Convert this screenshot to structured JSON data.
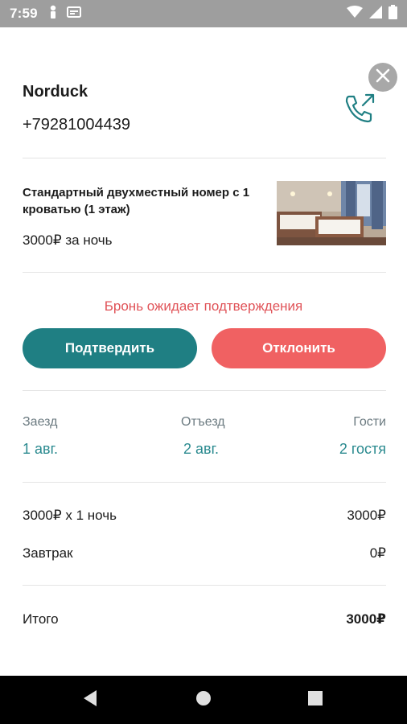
{
  "status_bar": {
    "time": "7:59",
    "icons": [
      "person-notification-icon",
      "sim-card-icon",
      "wifi-icon",
      "cellular-signal-icon",
      "battery-icon"
    ],
    "background": "#9e9e9e"
  },
  "header": {
    "close_icon": "close-icon",
    "host_name": "Norduck",
    "phone": "+79281004439",
    "call_icon": "phone-outgoing-icon",
    "accent_color": "#1f7f83"
  },
  "room": {
    "title": "Стандартный двухместный номер с 1 кроватью (1 этаж)",
    "price": "3000₽ за ночь"
  },
  "booking": {
    "status_text": "Бронь ожидает подтверждения",
    "status_color": "#e05358",
    "confirm_label": "Подтвердить",
    "decline_label": "Отклонить",
    "confirm_color": "#1f7f83",
    "decline_color": "#f06162"
  },
  "stay": {
    "checkin_label": "Заезд",
    "checkin_value": "1 авг.",
    "checkout_label": "Отъезд",
    "checkout_value": "2 авг.",
    "guests_label": "Гости",
    "guests_value": "2 гостя"
  },
  "pricing": {
    "nights_label": "3000₽ x 1 ночь",
    "nights_value": "3000₽",
    "breakfast_label": "Завтрак",
    "breakfast_value": "0₽",
    "total_label": "Итого",
    "total_value": "3000₽"
  },
  "nav_bar": {
    "icons": [
      "back-icon",
      "home-icon",
      "recents-icon"
    ]
  }
}
